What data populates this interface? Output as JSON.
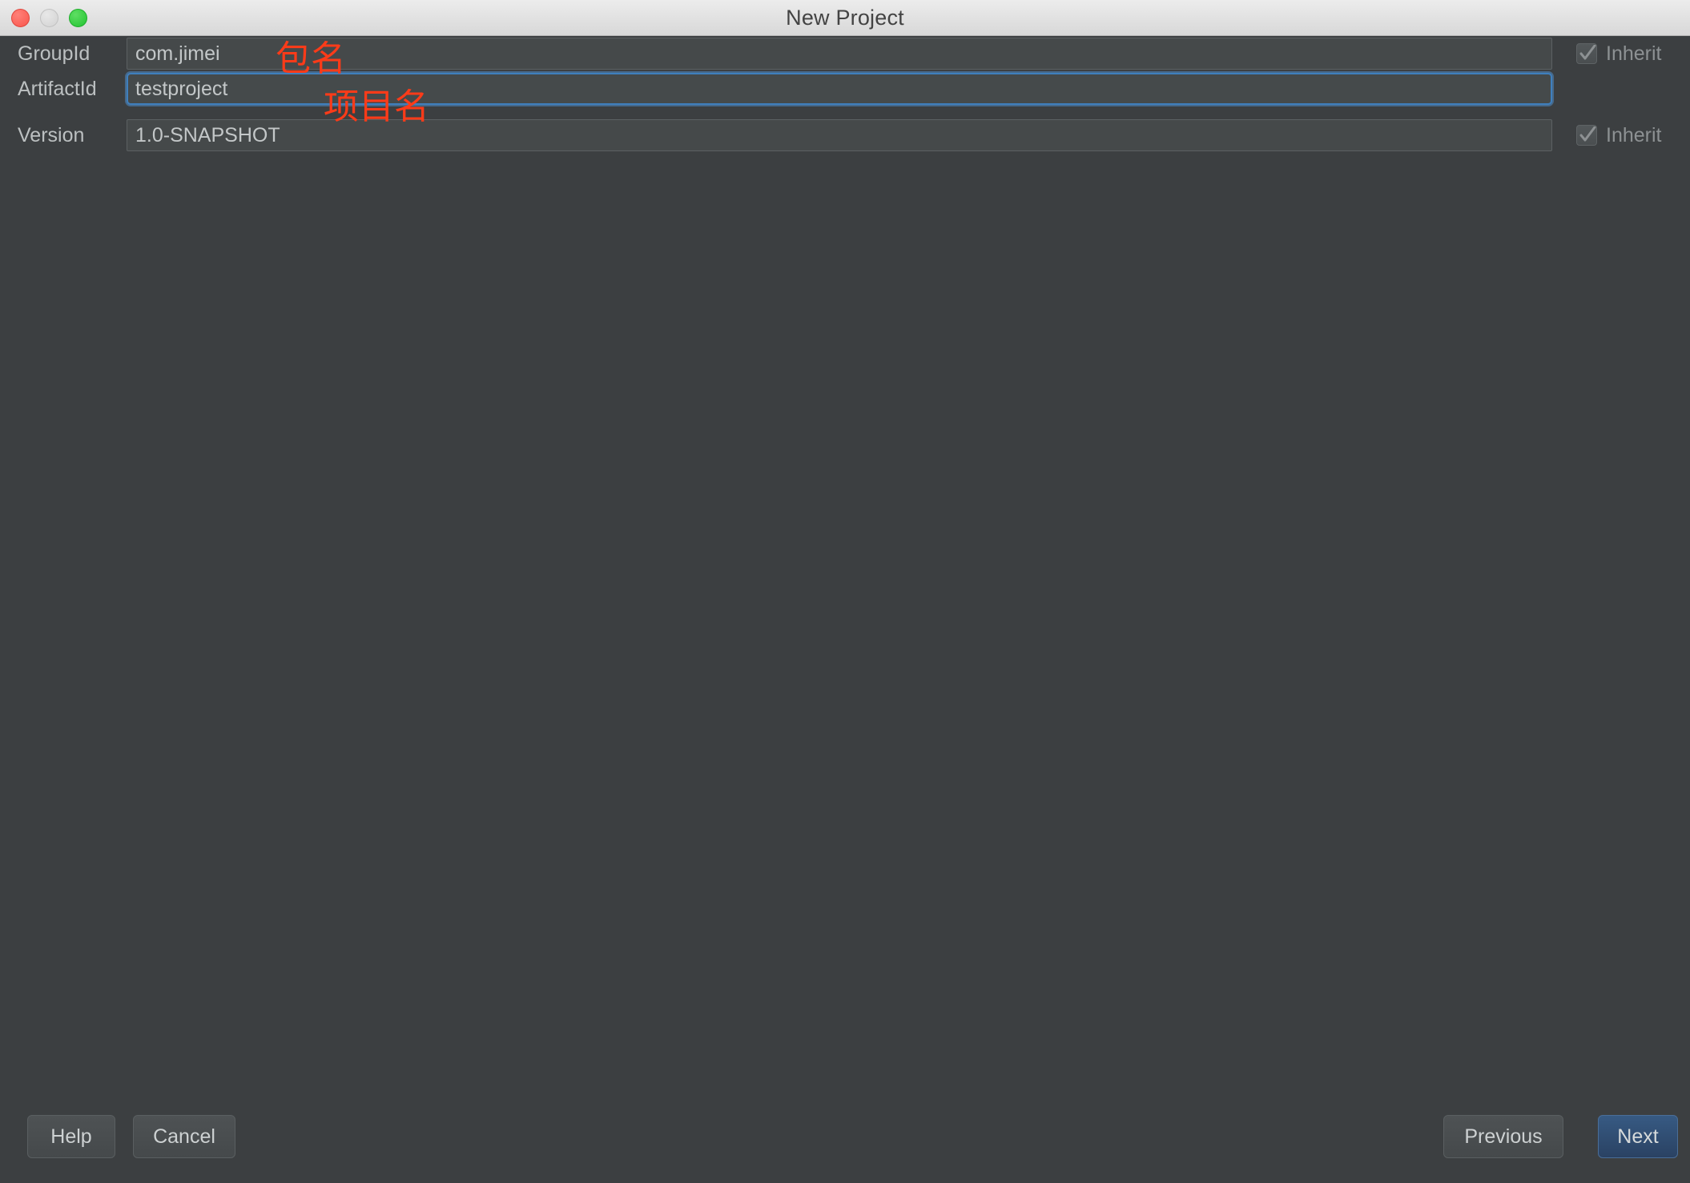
{
  "window": {
    "title": "New Project",
    "traffic_lights": [
      {
        "name": "close-button",
        "color": "#f9564c"
      },
      {
        "name": "minimize-button",
        "color": "#d2d2d2"
      },
      {
        "name": "maximize-button",
        "color": "#23c431"
      }
    ]
  },
  "form": {
    "rows": [
      {
        "label": "GroupId",
        "value": "com.jimei",
        "focused": false,
        "inherit": {
          "label": "Inherit",
          "checked": true,
          "enabled": false
        }
      },
      {
        "label": "ArtifactId",
        "value": "testproject",
        "focused": true,
        "inherit": null
      },
      {
        "label": "Version",
        "value": "1.0-SNAPSHOT",
        "focused": false,
        "inherit": {
          "label": "Inherit",
          "checked": true,
          "enabled": false
        }
      }
    ]
  },
  "annotations": {
    "color": "#fb3b19",
    "group_id_note": "包名",
    "artifact_id_note": "项目名"
  },
  "buttons": {
    "help": "Help",
    "cancel": "Cancel",
    "previous": "Previous",
    "next": "Next"
  }
}
